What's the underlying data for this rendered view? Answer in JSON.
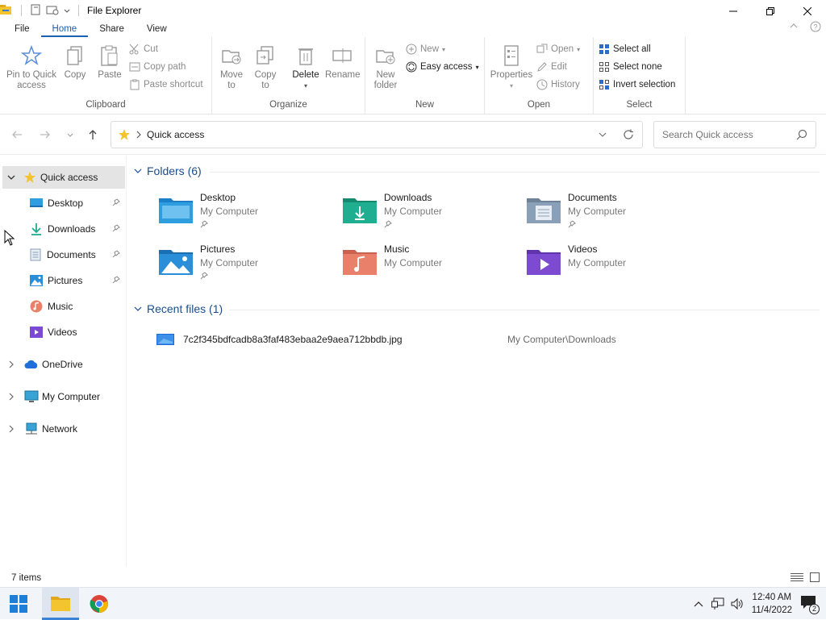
{
  "window": {
    "title": "File Explorer"
  },
  "tabs": [
    {
      "label": "File"
    },
    {
      "label": "Home"
    },
    {
      "label": "Share"
    },
    {
      "label": "View"
    }
  ],
  "ribbon": {
    "clipboard": {
      "label": "Clipboard",
      "pin_label_1": "Pin to Quick",
      "pin_label_2": "access",
      "copy": "Copy",
      "paste": "Paste",
      "cut": "Cut",
      "copy_path": "Copy path",
      "paste_shortcut": "Paste shortcut"
    },
    "organize": {
      "label": "Organize",
      "move_1": "Move",
      "move_2": "to",
      "copyto_1": "Copy",
      "copyto_2": "to",
      "delete": "Delete",
      "rename": "Rename"
    },
    "new": {
      "label": "New",
      "new_folder_1": "New",
      "new_folder_2": "folder",
      "new_item": "New",
      "easy_access": "Easy access"
    },
    "open": {
      "label": "Open",
      "properties": "Properties",
      "open": "Open",
      "edit": "Edit",
      "history": "History"
    },
    "select": {
      "label": "Select",
      "select_all": "Select all",
      "select_none": "Select none",
      "invert": "Invert selection"
    }
  },
  "address": {
    "crumb": "Quick access",
    "search_placeholder": "Search Quick access"
  },
  "sidebar": {
    "quick_access": "Quick access",
    "items": [
      {
        "label": "Desktop",
        "pinned": true
      },
      {
        "label": "Downloads",
        "pinned": true
      },
      {
        "label": "Documents",
        "pinned": true
      },
      {
        "label": "Pictures",
        "pinned": true
      },
      {
        "label": "Music",
        "pinned": false
      },
      {
        "label": "Videos",
        "pinned": false
      }
    ],
    "onedrive": "OneDrive",
    "my_computer": "My Computer",
    "network": "Network"
  },
  "folders": {
    "heading": "Folders (6)",
    "items": [
      {
        "name": "Desktop",
        "location": "My Computer",
        "color": "#2f9ee0"
      },
      {
        "name": "Downloads",
        "location": "My Computer",
        "color": "#1fae8f"
      },
      {
        "name": "Documents",
        "location": "My Computer",
        "color": "#8aa0b8"
      },
      {
        "name": "Pictures",
        "location": "My Computer",
        "color": "#2a8fd8"
      },
      {
        "name": "Music",
        "location": "My Computer",
        "color": "#e9806a"
      },
      {
        "name": "Videos",
        "location": "My Computer",
        "color": "#7d4bd1"
      }
    ]
  },
  "recent": {
    "heading": "Recent files (1)",
    "items": [
      {
        "name": "7c2f345bdfcadb8a3faf483ebaa2e9aea712bbdb.jpg",
        "path": "My Computer\\Downloads"
      }
    ]
  },
  "status": {
    "items_text": "7 items"
  },
  "taskbar": {
    "time": "12:40 AM",
    "date": "11/4/2022",
    "notification_count": "2"
  },
  "colors": {
    "accent": "#1a5fb4",
    "selection": "#e4e4e4"
  }
}
